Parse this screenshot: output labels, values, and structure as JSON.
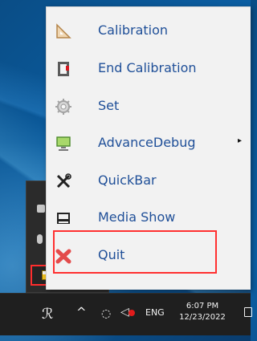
{
  "menu": {
    "items": [
      {
        "label": "Calibration",
        "icon": "triangle-ruler-icon",
        "has_submenu": false
      },
      {
        "label": "End Calibration",
        "icon": "stop-calibration-icon",
        "has_submenu": false
      },
      {
        "label": "Set",
        "icon": "gear-icon",
        "has_submenu": false
      },
      {
        "label": "AdvanceDebug",
        "icon": "monitor-icon",
        "has_submenu": true
      },
      {
        "label": "QuickBar",
        "icon": "tools-icon",
        "has_submenu": false
      },
      {
        "label": "Media Show",
        "icon": "media-show-icon",
        "has_submenu": false
      },
      {
        "label": "Quit",
        "icon": "close-icon",
        "has_submenu": false
      }
    ],
    "submenu_arrow": "▸"
  },
  "taskbar": {
    "language": "ENG",
    "time": "6:07 PM",
    "date": "12/23/2022"
  },
  "colors": {
    "menu_text": "#1f4f98",
    "highlight": "#ff3030",
    "taskbar": "#1f1f1f",
    "desktop": "#0b5fa4"
  }
}
